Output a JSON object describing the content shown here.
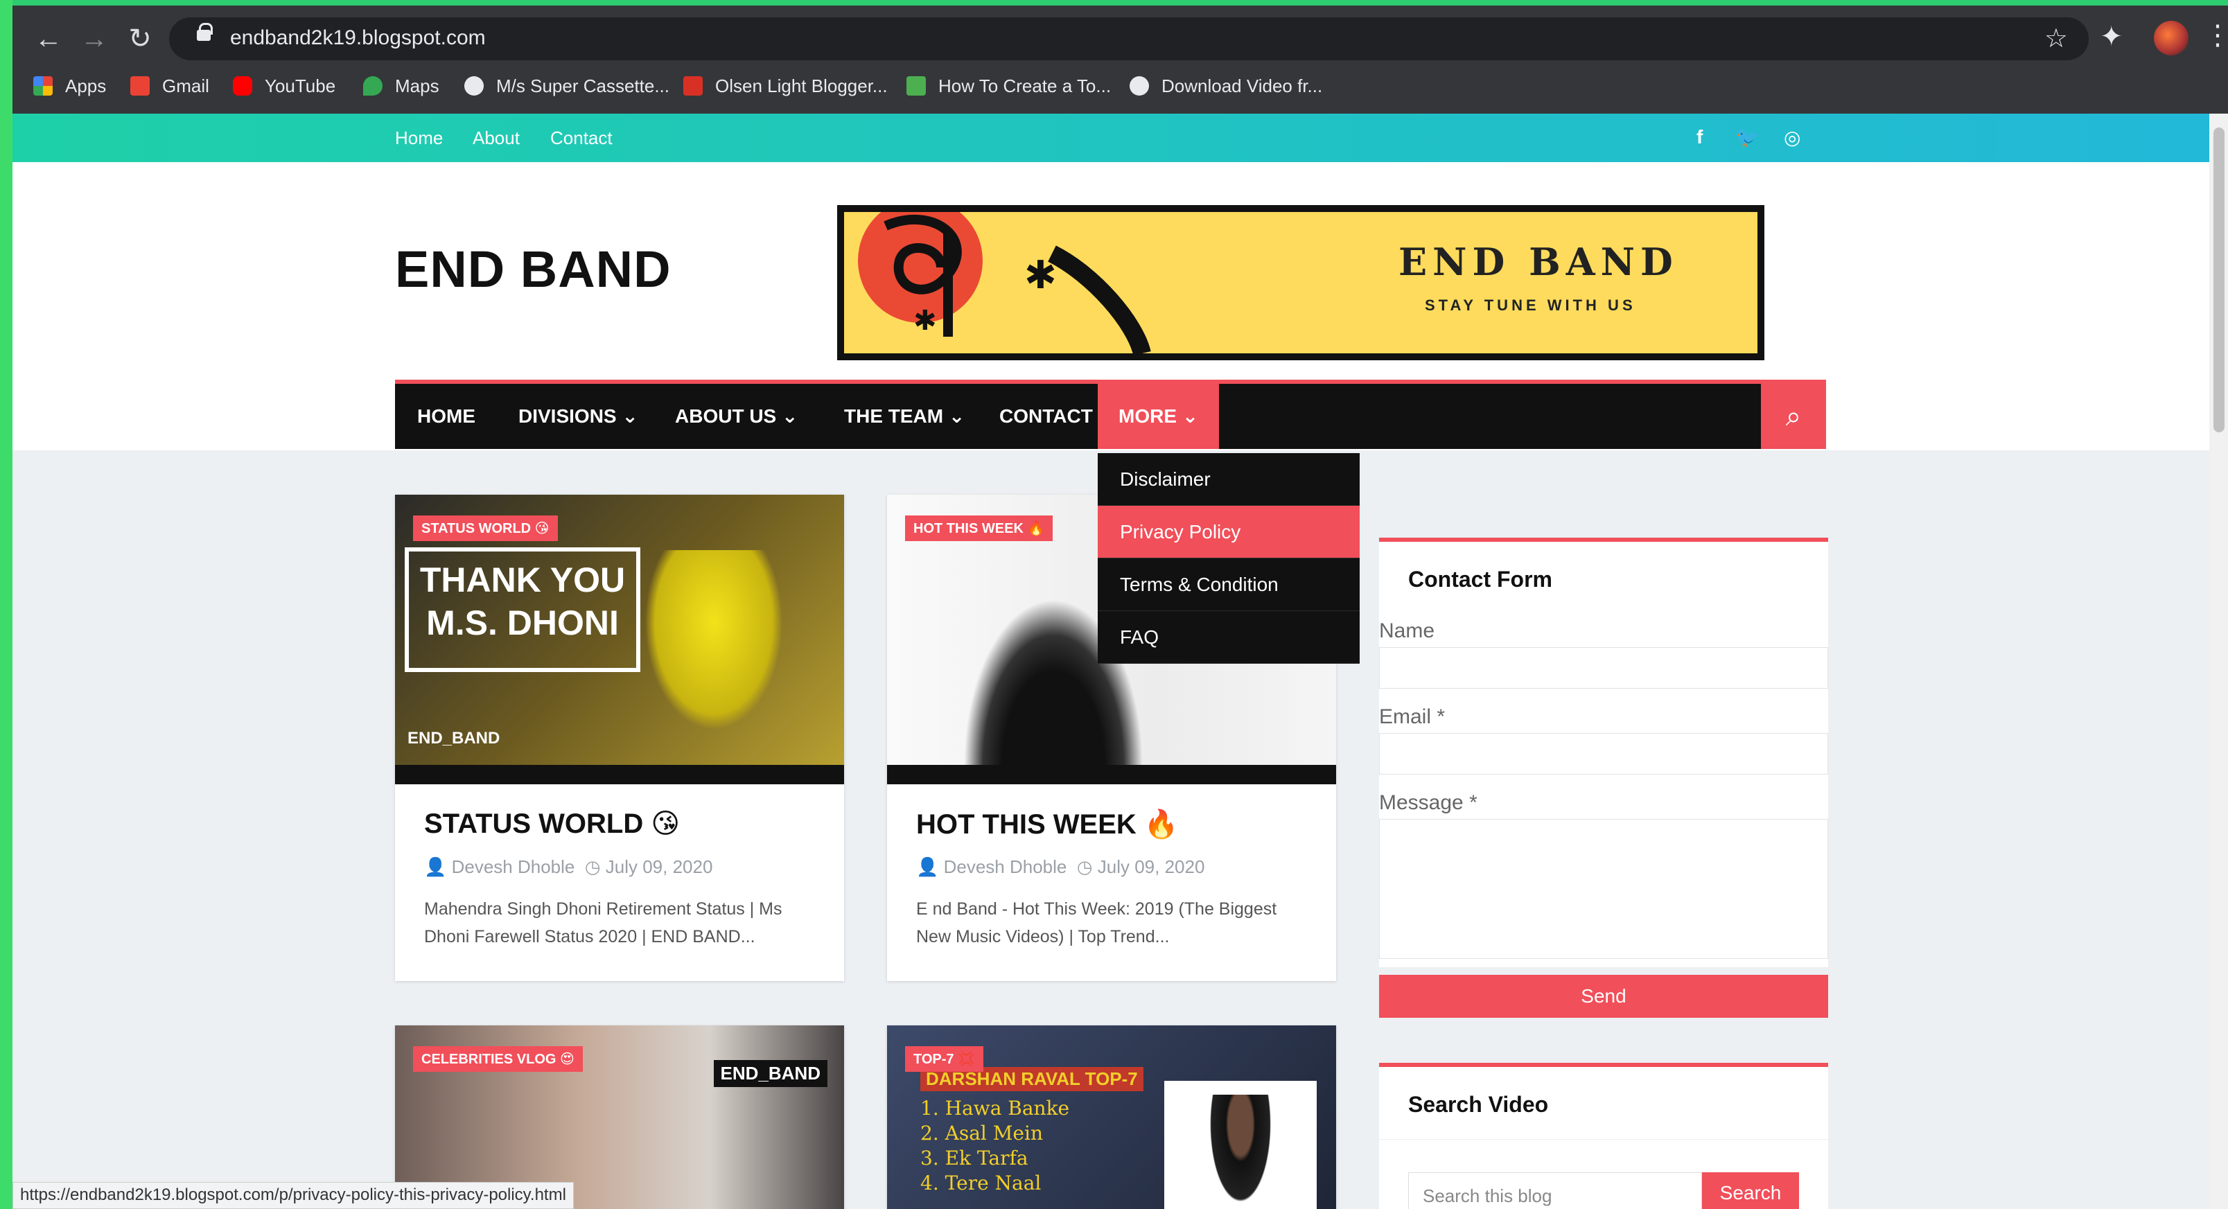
{
  "browser": {
    "url": "endband2k19.blogspot.com",
    "bookmarks": [
      {
        "label": "Apps",
        "icon": "apps-grid-icon",
        "color": "#4285f4"
      },
      {
        "label": "Gmail",
        "icon": "gmail-icon",
        "color": "#ea4335"
      },
      {
        "label": "YouTube",
        "icon": "youtube-icon",
        "color": "#ff0000"
      },
      {
        "label": "Maps",
        "icon": "maps-pin-icon",
        "color": "#34a853"
      },
      {
        "label": "M/s Super Cassette...",
        "icon": "globe-icon",
        "color": "#e8eaed"
      },
      {
        "label": "Olsen Light Blogger...",
        "icon": "blogger-icon",
        "color": "#d93025"
      },
      {
        "label": "How To Create a To...",
        "icon": "w3-icon",
        "color": "#4caf50"
      },
      {
        "label": "Download Video fr...",
        "icon": "globe-icon",
        "color": "#e8eaed"
      }
    ],
    "status_url": "https://endband2k19.blogspot.com/p/privacy-policy-this-privacy-policy.html"
  },
  "topbar": {
    "links": [
      "Home",
      "About",
      "Contact"
    ],
    "social": [
      "f",
      "t",
      "ig"
    ]
  },
  "site": {
    "title": "END BAND",
    "banner_title": "END BAND",
    "banner_subtitle": "STAY TUNE WITH US"
  },
  "nav": {
    "items": [
      "HOME",
      "DIVISIONS",
      "ABOUT US",
      "THE TEAM",
      "CONTACT",
      "MORE"
    ],
    "chevron": "⌄"
  },
  "dropdown": {
    "items": [
      "Disclaimer",
      "Privacy Policy",
      "Terms & Condition",
      "FAQ"
    ],
    "active": "Privacy Policy"
  },
  "posts": [
    {
      "label": "STATUS WORLD 😘",
      "title": "STATUS WORLD 😘",
      "author": "Devesh Dhoble",
      "date": "July 09, 2020",
      "excerpt": "Mahendra Singh Dhoni Retirement Status | Ms Dhoni Farewell Status 2020 | END BAND...",
      "thumb_text1": "THANK YOU",
      "thumb_text2": "M.S. DHONI",
      "thumb_corner": "END_BAND"
    },
    {
      "label": "HOT THIS WEEK 🔥",
      "title": "HOT THIS WEEK 🔥",
      "author": "Devesh Dhoble",
      "date": "July 09, 2020",
      "excerpt": "E nd Band - Hot This Week: 2019 (The Biggest New Music Videos) | Top Trend..."
    },
    {
      "label": "CELEBRITIES VLOG 😍",
      "thumb_corner": "END_BAND"
    },
    {
      "label": "TOP-7 💢",
      "thumb_heading": "DARSHAN RAVAL TOP-7",
      "thumb_list": [
        "1. Hawa Banke",
        "2. Asal Mein",
        "3. Ek Tarfa",
        "4. Tere Naal"
      ]
    }
  ],
  "contact_form": {
    "title": "Contact Form",
    "name_label": "Name",
    "email_label": "Email *",
    "message_label": "Message *",
    "send_label": "Send"
  },
  "search_widget": {
    "title": "Search Video",
    "placeholder": "Search this blog",
    "button": "Search"
  },
  "colors": {
    "accent": "#f14f5a",
    "topbar_start": "#1ed0a8",
    "topbar_end": "#22b8d8"
  }
}
